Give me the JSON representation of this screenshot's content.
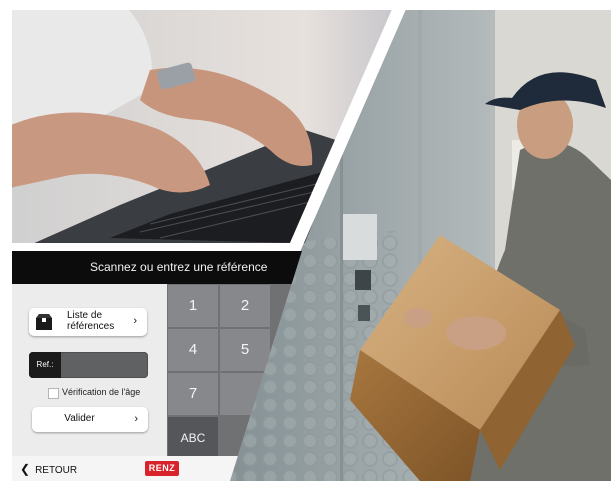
{
  "kiosk": {
    "header": "Scannez ou entrez une référence",
    "list_button": {
      "label": "Liste de références",
      "icon": "box-icon",
      "chevron": "›"
    },
    "ref_field": {
      "tag": "Ref.:",
      "value": ""
    },
    "age_checkbox": {
      "label": "Vérification de l'âge",
      "checked": false
    },
    "validate_button": {
      "label": "Valider",
      "chevron": "›"
    },
    "keypad": {
      "keys": [
        "1",
        "2",
        "4",
        "5",
        "7",
        "ABC"
      ]
    },
    "footer": {
      "back_label": "RETOUR",
      "back_icon": "chevron-left-icon",
      "logo": "RENZ"
    }
  },
  "colors": {
    "header_bg": "#0c0c0c",
    "keypad_bg": "#6f7173",
    "logo_red": "#d8232a"
  }
}
